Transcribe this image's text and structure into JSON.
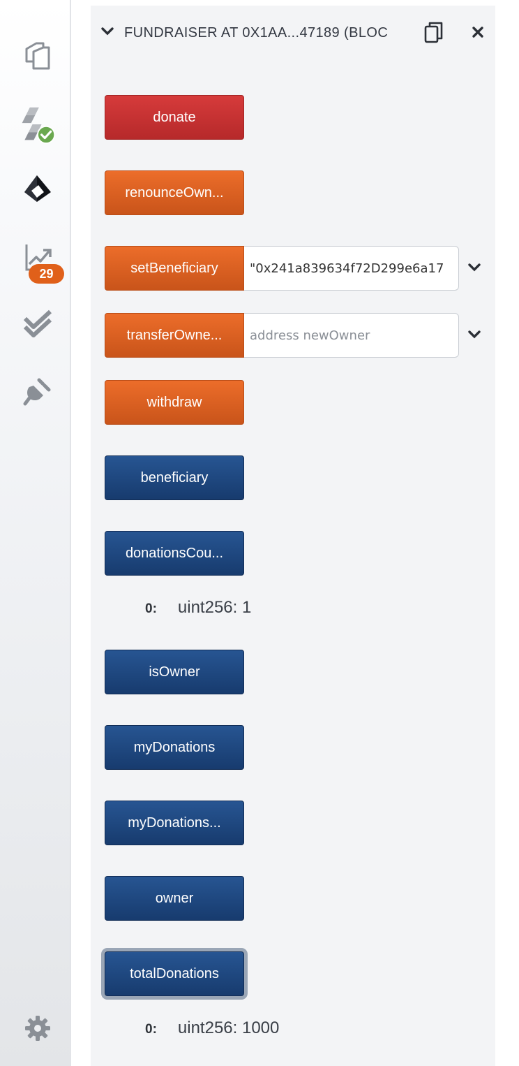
{
  "rail": {
    "icons": [
      {
        "name": "file-explorer-icon"
      },
      {
        "name": "solidity-compiler-icon"
      },
      {
        "name": "deploy-run-icon"
      },
      {
        "name": "analysis-icon"
      },
      {
        "name": "testing-icon"
      },
      {
        "name": "plugin-manager-icon"
      },
      {
        "name": "settings-icon"
      }
    ],
    "analysis_badge": "29"
  },
  "instance": {
    "title": "FUNDRAISER AT 0X1AA...47189 (BLOC"
  },
  "functions": {
    "donate": "donate",
    "renounce": "renounceOwn...",
    "set_beneficiary": "setBeneficiary",
    "set_beneficiary_value": "\"0x241a839634f72D299e6a17",
    "transfer_ownership": "transferOwne...",
    "transfer_ownership_placeholder": "address newOwner",
    "withdraw": "withdraw",
    "beneficiary": "beneficiary",
    "donations_count": "donationsCou...",
    "is_owner": "isOwner",
    "my_donations": "myDonations",
    "my_donations_count": "myDonations...",
    "owner": "owner",
    "total_donations": "totalDonations"
  },
  "results": {
    "donations_count": {
      "index": "0:",
      "value": "uint256: 1"
    },
    "total_donations": {
      "index": "0:",
      "value": "uint256: 1000"
    }
  },
  "colors": {
    "payable": "#c0302f",
    "transact": "#dd6223",
    "call": "#1e4a86",
    "badge": "#e0601a",
    "compiled_ok": "#6aa84f"
  }
}
